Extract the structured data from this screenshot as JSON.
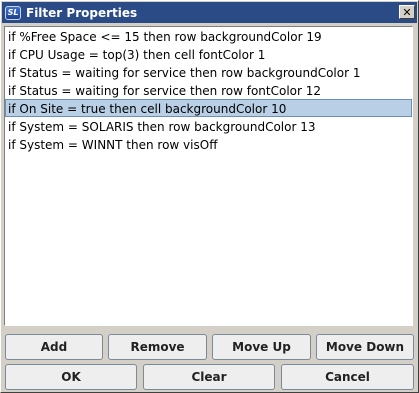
{
  "window": {
    "title": "Filter Properties",
    "icon_text": "SL",
    "close_symbol": "✕"
  },
  "filters": {
    "items": [
      "if %Free Space <= 15 then row backgroundColor 19",
      "if CPU Usage = top(3) then cell fontColor 1",
      "if Status = waiting for service then row backgroundColor 1",
      "if Status = waiting for service then row fontColor 12",
      "if On Site = true then cell backgroundColor 10",
      "if System = SOLARIS then row backgroundColor 13",
      "if System = WINNT then row visOff"
    ],
    "selected_index": 4
  },
  "actions": {
    "add": "Add",
    "remove": "Remove",
    "move_up": "Move Up",
    "move_down": "Move Down"
  },
  "dialog": {
    "ok": "OK",
    "clear": "Clear",
    "cancel": "Cancel"
  },
  "colors": {
    "titlebar": "#2a4b86",
    "selection": "#b8cfe5"
  }
}
